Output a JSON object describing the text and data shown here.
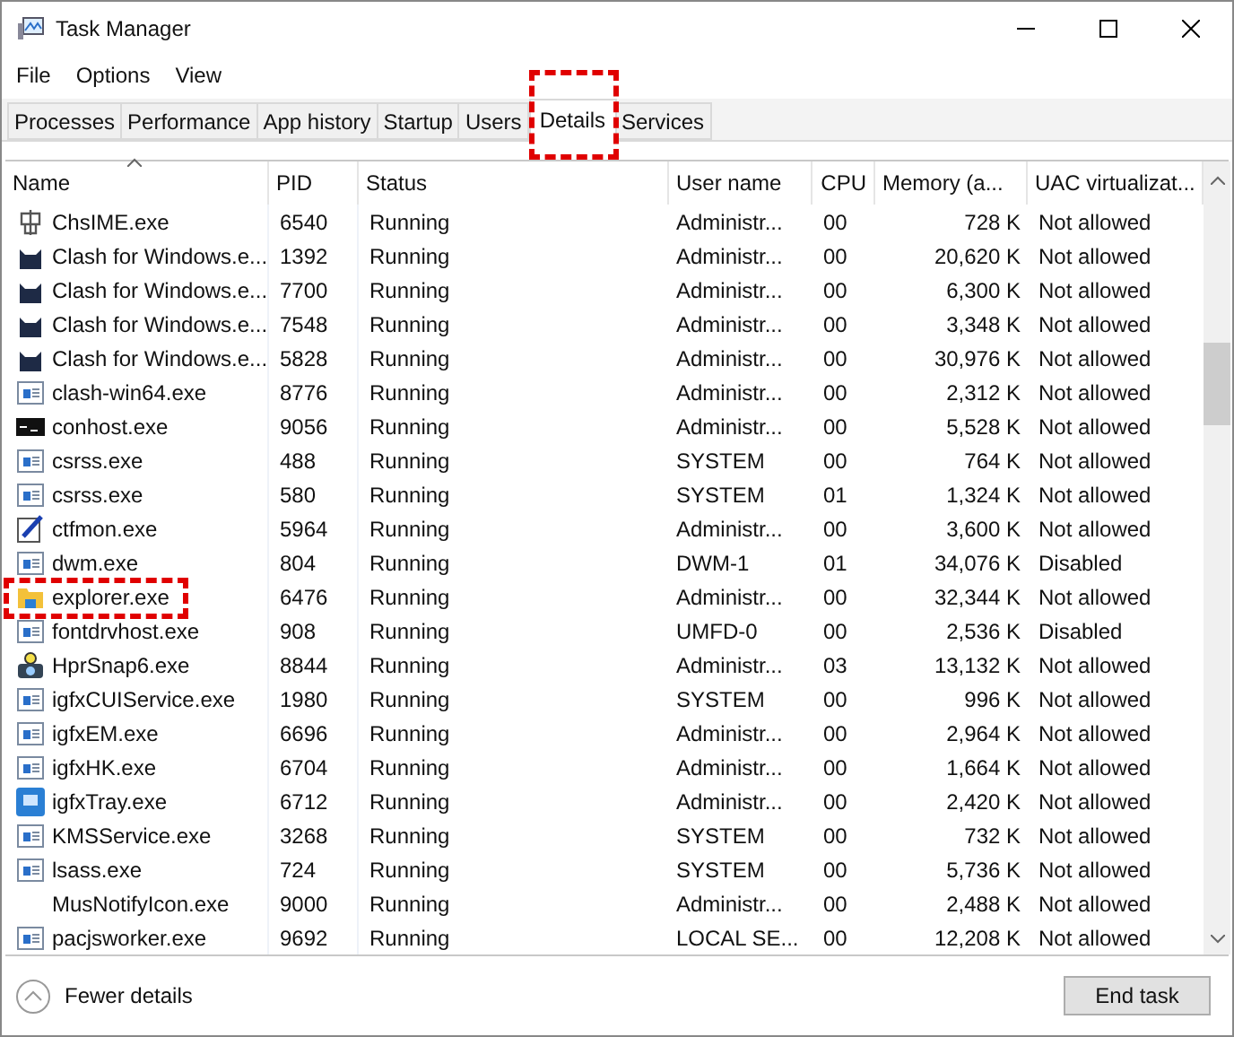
{
  "window": {
    "title": "Task Manager"
  },
  "menu": [
    "File",
    "Options",
    "View"
  ],
  "tabs": [
    {
      "label": "Processes",
      "selected": false
    },
    {
      "label": "Performance",
      "selected": false
    },
    {
      "label": "App history",
      "selected": false
    },
    {
      "label": "Startup",
      "selected": false
    },
    {
      "label": "Users",
      "selected": false
    },
    {
      "label": "Details",
      "selected": true
    },
    {
      "label": "Services",
      "selected": false
    }
  ],
  "table": {
    "columns": [
      "Name",
      "PID",
      "Status",
      "User name",
      "CPU",
      "Memory (a...",
      "UAC virtualizat..."
    ],
    "rows": [
      {
        "kind": "ime",
        "name": "ChsIME.exe",
        "pid": "6540",
        "status": "Running",
        "user": "Administr...",
        "cpu": "00",
        "memory": "728 K",
        "uac": "Not allowed"
      },
      {
        "kind": "cat",
        "name": "Clash for Windows.e...",
        "pid": "1392",
        "status": "Running",
        "user": "Administr...",
        "cpu": "00",
        "memory": "20,620 K",
        "uac": "Not allowed"
      },
      {
        "kind": "cat",
        "name": "Clash for Windows.e...",
        "pid": "7700",
        "status": "Running",
        "user": "Administr...",
        "cpu": "00",
        "memory": "6,300 K",
        "uac": "Not allowed"
      },
      {
        "kind": "cat",
        "name": "Clash for Windows.e...",
        "pid": "7548",
        "status": "Running",
        "user": "Administr...",
        "cpu": "00",
        "memory": "3,348 K",
        "uac": "Not allowed"
      },
      {
        "kind": "cat",
        "name": "Clash for Windows.e...",
        "pid": "5828",
        "status": "Running",
        "user": "Administr...",
        "cpu": "00",
        "memory": "30,976 K",
        "uac": "Not allowed"
      },
      {
        "kind": "window",
        "name": "clash-win64.exe",
        "pid": "8776",
        "status": "Running",
        "user": "Administr...",
        "cpu": "00",
        "memory": "2,312 K",
        "uac": "Not allowed"
      },
      {
        "kind": "console",
        "name": "conhost.exe",
        "pid": "9056",
        "status": "Running",
        "user": "Administr...",
        "cpu": "00",
        "memory": "5,528 K",
        "uac": "Not allowed"
      },
      {
        "kind": "window",
        "name": "csrss.exe",
        "pid": "488",
        "status": "Running",
        "user": "SYSTEM",
        "cpu": "00",
        "memory": "764 K",
        "uac": "Not allowed"
      },
      {
        "kind": "window",
        "name": "csrss.exe",
        "pid": "580",
        "status": "Running",
        "user": "SYSTEM",
        "cpu": "01",
        "memory": "1,324 K",
        "uac": "Not allowed"
      },
      {
        "kind": "pen",
        "name": "ctfmon.exe",
        "pid": "5964",
        "status": "Running",
        "user": "Administr...",
        "cpu": "00",
        "memory": "3,600 K",
        "uac": "Not allowed"
      },
      {
        "kind": "window",
        "name": "dwm.exe",
        "pid": "804",
        "status": "Running",
        "user": "DWM-1",
        "cpu": "01",
        "memory": "34,076 K",
        "uac": "Disabled"
      },
      {
        "kind": "folder",
        "name": "explorer.exe",
        "pid": "6476",
        "status": "Running",
        "user": "Administr...",
        "cpu": "00",
        "memory": "32,344 K",
        "uac": "Not allowed"
      },
      {
        "kind": "window",
        "name": "fontdrvhost.exe",
        "pid": "908",
        "status": "Running",
        "user": "UMFD-0",
        "cpu": "00",
        "memory": "2,536 K",
        "uac": "Disabled"
      },
      {
        "kind": "camera",
        "name": "HprSnap6.exe",
        "pid": "8844",
        "status": "Running",
        "user": "Administr...",
        "cpu": "03",
        "memory": "13,132 K",
        "uac": "Not allowed"
      },
      {
        "kind": "window",
        "name": "igfxCUIService.exe",
        "pid": "1980",
        "status": "Running",
        "user": "SYSTEM",
        "cpu": "00",
        "memory": "996 K",
        "uac": "Not allowed"
      },
      {
        "kind": "window",
        "name": "igfxEM.exe",
        "pid": "6696",
        "status": "Running",
        "user": "Administr...",
        "cpu": "00",
        "memory": "2,964 K",
        "uac": "Not allowed"
      },
      {
        "kind": "window",
        "name": "igfxHK.exe",
        "pid": "6704",
        "status": "Running",
        "user": "Administr...",
        "cpu": "00",
        "memory": "1,664 K",
        "uac": "Not allowed"
      },
      {
        "kind": "tray",
        "name": "igfxTray.exe",
        "pid": "6712",
        "status": "Running",
        "user": "Administr...",
        "cpu": "00",
        "memory": "2,420 K",
        "uac": "Not allowed"
      },
      {
        "kind": "window",
        "name": "KMSService.exe",
        "pid": "3268",
        "status": "Running",
        "user": "SYSTEM",
        "cpu": "00",
        "memory": "732 K",
        "uac": "Not allowed"
      },
      {
        "kind": "window",
        "name": "lsass.exe",
        "pid": "724",
        "status": "Running",
        "user": "SYSTEM",
        "cpu": "00",
        "memory": "5,736 K",
        "uac": "Not allowed"
      },
      {
        "kind": "none",
        "name": "MusNotifyIcon.exe",
        "pid": "9000",
        "status": "Running",
        "user": "Administr...",
        "cpu": "00",
        "memory": "2,488 K",
        "uac": "Not allowed"
      },
      {
        "kind": "window",
        "name": "pacjsworker.exe",
        "pid": "9692",
        "status": "Running",
        "user": "LOCAL SE...",
        "cpu": "00",
        "memory": "12,208 K",
        "uac": "Not allowed"
      }
    ]
  },
  "footer": {
    "toggle": "Fewer details",
    "button": "End task"
  }
}
